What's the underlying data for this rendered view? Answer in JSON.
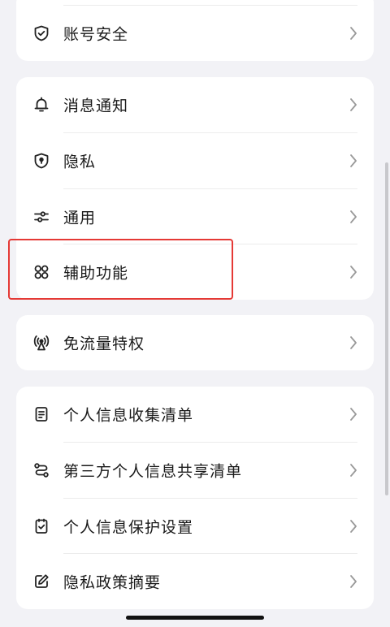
{
  "groups": [
    {
      "items": [
        {
          "label": "账号安全",
          "icon": "shield-check-icon"
        }
      ]
    },
    {
      "items": [
        {
          "label": "消息通知",
          "icon": "bell-icon"
        },
        {
          "label": "隐私",
          "icon": "shield-lock-icon"
        },
        {
          "label": "通用",
          "icon": "sliders-icon"
        },
        {
          "label": "辅助功能",
          "icon": "four-circles-icon"
        }
      ]
    },
    {
      "items": [
        {
          "label": "免流量特权",
          "icon": "signal-tower-icon"
        }
      ]
    },
    {
      "items": [
        {
          "label": "个人信息收集清单",
          "icon": "document-icon"
        },
        {
          "label": "第三方个人信息共享清单",
          "icon": "share-link-icon"
        },
        {
          "label": "个人信息保护设置",
          "icon": "checkbox-doc-icon"
        },
        {
          "label": "隐私政策摘要",
          "icon": "edit-icon"
        }
      ]
    }
  ],
  "highlight_color": "#e53935"
}
